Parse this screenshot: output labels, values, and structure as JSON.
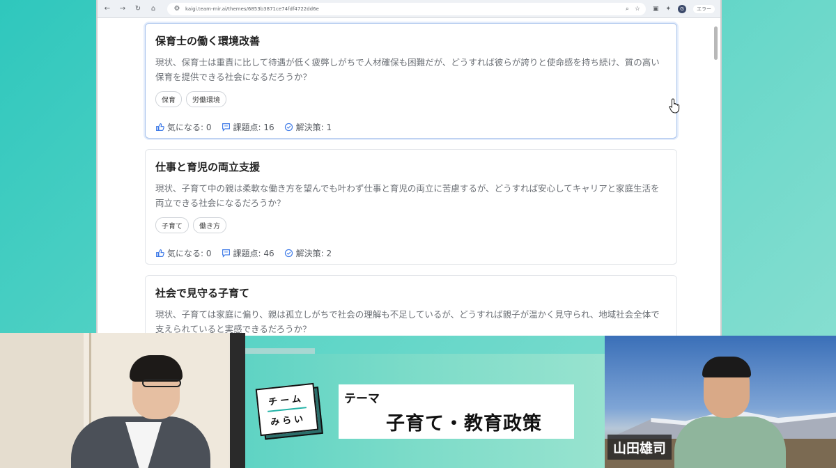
{
  "browser": {
    "url": "kaigi.team-mir.ai/themes/6853b3871ce74fdf4722dd6e",
    "profile_initial": "G",
    "error_label": "エラー"
  },
  "cards": [
    {
      "title": "保育士の働く環境改善",
      "description": "現状、保育士は重責に比して待遇が低く疲弊しがちで人材確保も困難だが、どうすれば彼らが誇りと使命感を持ち続け、質の高い保育を提供できる社会になるだろうか？",
      "tags": [
        "保育",
        "労働環境"
      ],
      "likes": "気になる: 0",
      "issues": "課題点: 16",
      "solutions": "解決策: 1"
    },
    {
      "title": "仕事と育児の両立支援",
      "description": "現状、子育て中の親は柔軟な働き方を望んでも叶わず仕事と育児の両立に苦慮するが、どうすれば安心してキャリアと家庭生活を両立できる社会になるだろうか？",
      "tags": [
        "子育て",
        "働き方"
      ],
      "likes": "気になる: 0",
      "issues": "課題点: 46",
      "solutions": "解決策: 2"
    },
    {
      "title": "社会で見守る子育て",
      "description": "現状、子育ては家庭に偏り、親は孤立しがちで社会の理解も不足しているが、どうすれば親子が温かく見守られ、地域社会全体で支えられていると実感できるだろうか？"
    }
  ],
  "banner": {
    "logo_line1": "チーム",
    "logo_line2": "みらい",
    "theme_label": "テーマ",
    "theme_title": "子育て・教育政策"
  },
  "participant": {
    "name": "山田雄司"
  },
  "colors": {
    "accent_teal": "#24b3a7",
    "card_active_border": "#a9c3ec",
    "icon_blue": "#3b78e7"
  }
}
